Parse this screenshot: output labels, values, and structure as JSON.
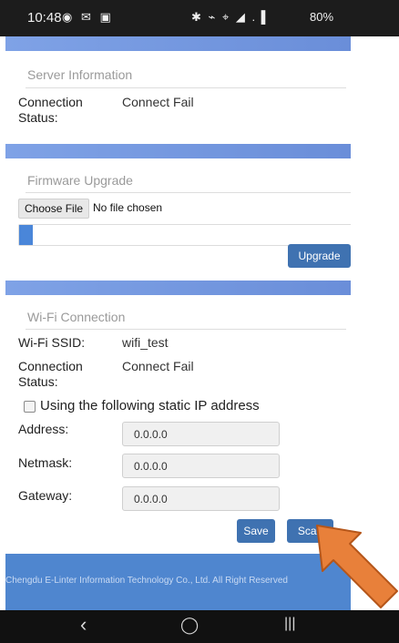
{
  "status_bar": {
    "time": "10:48",
    "notif_icons": "◉ ✉ ▣",
    "sys_icons": "✱ ⌁ ⌖ ◢ .▐",
    "battery": "80%"
  },
  "server": {
    "title": "Server Information",
    "status_label": "Connection Status:",
    "status_value": "Connect Fail"
  },
  "firmware": {
    "title": "Firmware Upgrade",
    "choose_file_label": "Choose File",
    "no_file_text": "No file chosen",
    "upgrade_label": "Upgrade",
    "progress": 0.04
  },
  "wifi": {
    "title": "Wi-Fi Connection",
    "ssid_label": "Wi-Fi SSID:",
    "ssid_value": "wifi_test",
    "status_label": "Connection Status:",
    "status_value": "Connect Fail",
    "static_ip_label": "Using the following static IP address",
    "static_ip_checked": false,
    "fields": [
      {
        "label": "Address:",
        "value": "0.0.0.0"
      },
      {
        "label": "Netmask:",
        "value": "0.0.0.0"
      },
      {
        "label": "Gateway:",
        "value": "0.0.0.0"
      }
    ],
    "save_label": "Save",
    "scan_label": "Scan"
  },
  "footer": {
    "text": "Chengdu E-Linter Information Technology Co., Ltd. All Right Reserved"
  },
  "nav_bar": {
    "back": "‹",
    "home": "◯",
    "recents": "|||"
  },
  "colors": {
    "accent": "#3f72b1",
    "band": "#7497e0",
    "footer": "#4f86cf",
    "arrow": "#e8803a"
  }
}
